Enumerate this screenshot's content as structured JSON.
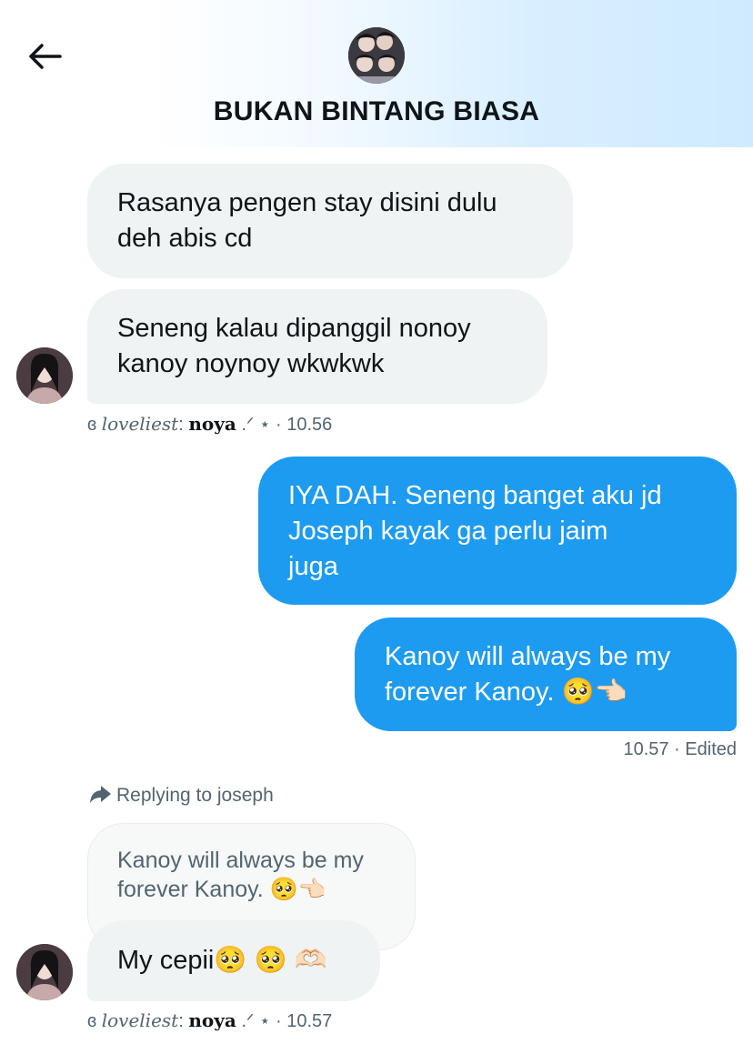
{
  "header": {
    "title": "BUKAN BINTANG BIASA"
  },
  "messages": [
    {
      "text": "Rasanya pengen stay disini dulu\ndeh abis cd"
    },
    {
      "text": "Seneng kalau dipanggil nonoy\nkanoy noynoy wkwkwk"
    },
    {
      "text": "IYA DAH. Seneng banget aku jd\nJoseph kayak ga perlu jaim\njuga"
    },
    {
      "text": "Kanoy will always be my\nforever Kanoy. 🥺👈🏻"
    },
    {
      "text": "My cepii🥺 🥺 🫶🏻"
    }
  ],
  "meta1": {
    "prefix": "ɞ ",
    "name_italic": "loveliest",
    "colon": ": ",
    "name_bold": "noya",
    "suffix": " .ᐟ ⋆ · 10.56"
  },
  "meta_out": {
    "text": "10.57 · Edited"
  },
  "reply": {
    "label": "Replying to joseph",
    "quote": "Kanoy will always be my\nforever Kanoy. 🥺👈🏻"
  },
  "meta2": {
    "prefix": "ɞ ",
    "name_italic": "loveliest",
    "colon": ": ",
    "name_bold": "noya",
    "suffix": " .ᐟ ⋆ · 10.57"
  },
  "colors": {
    "accent": "#1d9bf0",
    "incoming": "#eff3f4",
    "muted": "#536471"
  },
  "icons": {
    "back": "arrow-left-icon",
    "reply": "reply-arrow-icon"
  }
}
